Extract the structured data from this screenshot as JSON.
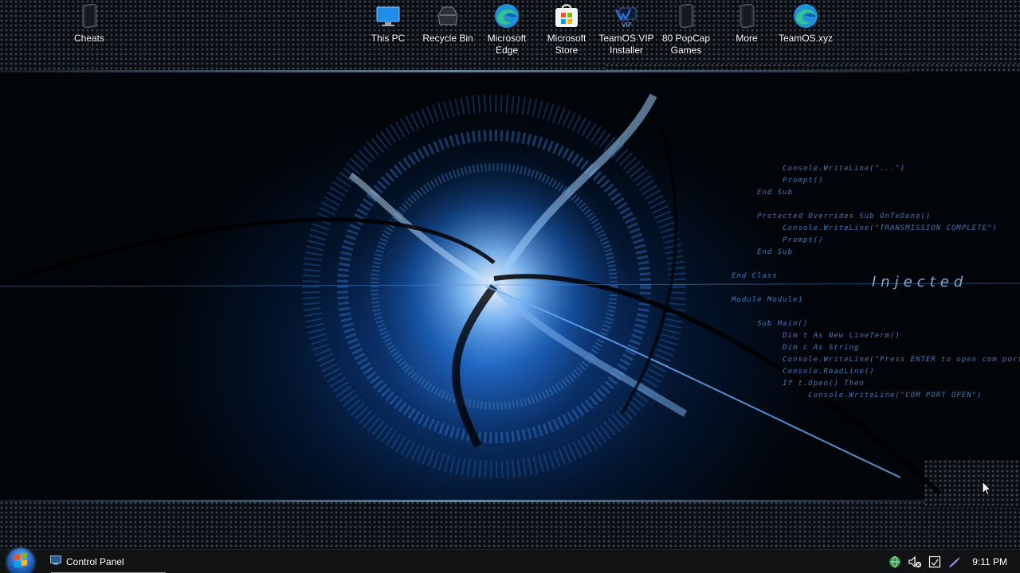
{
  "desktop": {
    "icons": [
      {
        "label": "Cheats",
        "icon": "folder-dark-icon"
      },
      {
        "label": "This PC",
        "icon": "monitor-icon"
      },
      {
        "label": "Recycle Bin",
        "icon": "recycle-bin-icon"
      },
      {
        "label": "Microsoft Edge",
        "icon": "edge-icon"
      },
      {
        "label": "Microsoft Store",
        "icon": "store-icon"
      },
      {
        "label": "TeamOS VIP Installer",
        "icon": "installer-icon"
      },
      {
        "label": "80 PopCap Games",
        "icon": "folder-dark-icon"
      },
      {
        "label": "More",
        "icon": "folder-dark-icon"
      },
      {
        "label": "TeamOS.xyz",
        "icon": "edge-icon"
      }
    ]
  },
  "wallpaper": {
    "code_lines": [
      "          Console.WriteLine(\"...\")",
      "          Prompt()",
      "     End Sub",
      "",
      "     Protected Overrides Sub OnTxDone()",
      "          Console.WriteLine(\"TRANSMISSION COMPLETE\")",
      "          Prompt()",
      "     End Sub",
      "",
      "End Class",
      "",
      "Module Module1",
      "",
      "     Sub Main()",
      "          Dim t As New LineTerm()",
      "          Dim c As String",
      "          Console.WriteLine(\"Press ENTER to open com port\")",
      "          Console.ReadLine()",
      "          If t.Open() Then",
      "               Console.WriteLine(\"COM PORT OPEN\")"
    ],
    "injected_text": "Injected"
  },
  "taskbar": {
    "start_icon": "windows-start-orb-icon",
    "open_window": {
      "label": "Control Panel",
      "icon": "control-panel-icon"
    },
    "tray": [
      "network-globe-icon",
      "volume-icon",
      "action-center-icon",
      "pen-icon"
    ],
    "clock": "9:11 PM"
  },
  "colors": {
    "taskbar_bg": "#101214",
    "accent": "#4aa3ff",
    "wallpaper_glow": "#1a5fb0"
  }
}
